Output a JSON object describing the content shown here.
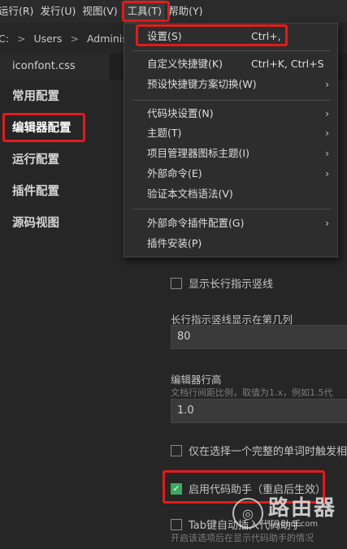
{
  "menubar": {
    "items": [
      "运行(R)",
      "发行(U)",
      "视图(V)",
      "工具(T)",
      "帮助(Y)"
    ]
  },
  "breadcrumb": {
    "drive": "C:",
    "sep": ">",
    "p1": "Users",
    "p2": "Administrat"
  },
  "tab": {
    "label": "iconfont.css"
  },
  "sidebar": {
    "items": [
      "常用配置",
      "编辑器配置",
      "运行配置",
      "插件配置",
      "源码视图"
    ]
  },
  "dropdown": {
    "items": [
      {
        "label": "设置(S)",
        "shortcut": "Ctrl+,"
      },
      {
        "label": "自定义快捷键(K)",
        "shortcut": "Ctrl+K, Ctrl+S"
      },
      {
        "label": "预设快捷键方案切换(W)",
        "arrow": "›"
      },
      {
        "label": "代码块设置(N)",
        "arrow": "›"
      },
      {
        "label": "主题(T)",
        "arrow": "›"
      },
      {
        "label": "项目管理器图标主题(I)",
        "arrow": "›"
      },
      {
        "label": "外部命令(E)",
        "arrow": "›"
      },
      {
        "label": "验证本文档语法(V)"
      },
      {
        "label": "外部命令插件配置(G)",
        "arrow": "›"
      },
      {
        "label": "插件安装(P)"
      }
    ]
  },
  "settings": {
    "show_long_line_guide": "显示长行指示竖线",
    "long_line_column_label": "长行指示竖线显示在第几列",
    "long_line_column_value": "80",
    "line_height_label": "编辑器行高",
    "line_height_desc": "文档行间距比例，取值为1.x，例如1.5代",
    "line_height_value": "1.0",
    "word_select_trigger": "仅在选择一个完整的单词时触发相",
    "code_assistant": "启用代码助手（重启后生效）",
    "tab_key_label": "Tab键自动插入代码助手",
    "tab_key_desc": "开启该选项后在显示代码助手的情况"
  },
  "watermark": {
    "title": "路由器",
    "url": "luyouqi.com"
  },
  "colors": {
    "highlight_red": "#e21b1b",
    "checkbox_green": "#3da860",
    "background": "#262626"
  }
}
